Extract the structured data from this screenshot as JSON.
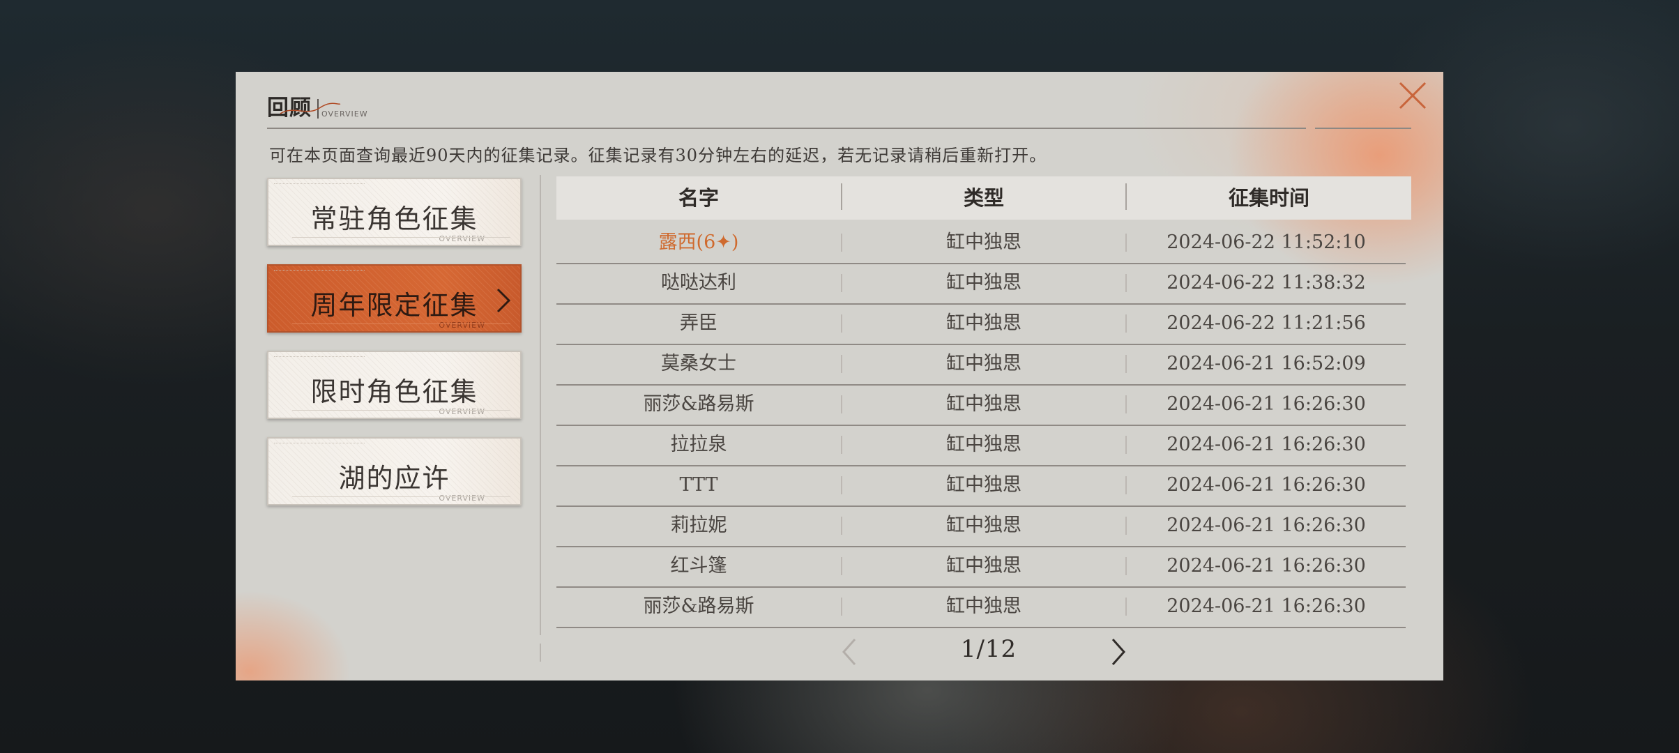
{
  "header": {
    "title": "回顾",
    "subtitle": "OVERVIEW",
    "description": "可在本页面查询最近90天内的征集记录。征集记录有30分钟左右的延迟，若无记录请稍后重新打开。"
  },
  "categories": [
    {
      "label": "常驻角色征集",
      "tag": "OVERVIEW",
      "active": false
    },
    {
      "label": "周年限定征集",
      "tag": "OVERVIEW",
      "active": true
    },
    {
      "label": "限时角色征集",
      "tag": "OVERVIEW",
      "active": false
    },
    {
      "label": "湖的应许",
      "tag": "OVERVIEW",
      "active": false
    }
  ],
  "table": {
    "columns": [
      "名字",
      "类型",
      "征集时间"
    ],
    "rows": [
      {
        "name": "露西(6✦)",
        "type": "缸中独思",
        "time": "2024-06-22 11:52:10",
        "highlight": true
      },
      {
        "name": "哒哒达利",
        "type": "缸中独思",
        "time": "2024-06-22 11:38:32"
      },
      {
        "name": "弄臣",
        "type": "缸中独思",
        "time": "2024-06-22 11:21:56"
      },
      {
        "name": "莫桑女士",
        "type": "缸中独思",
        "time": "2024-06-21 16:52:09"
      },
      {
        "name": "丽莎&路易斯",
        "type": "缸中独思",
        "time": "2024-06-21 16:26:30"
      },
      {
        "name": "拉拉泉",
        "type": "缸中独思",
        "time": "2024-06-21 16:26:30"
      },
      {
        "name": "TTT",
        "type": "缸中独思",
        "time": "2024-06-21 16:26:30"
      },
      {
        "name": "莉拉妮",
        "type": "缸中独思",
        "time": "2024-06-21 16:26:30"
      },
      {
        "name": "红斗篷",
        "type": "缸中独思",
        "time": "2024-06-21 16:26:30"
      },
      {
        "name": "丽莎&路易斯",
        "type": "缸中独思",
        "time": "2024-06-21 16:26:30"
      }
    ]
  },
  "pagination": {
    "current": 1,
    "total": 12,
    "label": "1/12"
  },
  "icons": {
    "close": "close-icon",
    "prev": "chevron-left-icon",
    "next": "chevron-right-icon",
    "active_arrow": "chevron-right-icon"
  },
  "colors": {
    "accent": "#cc5c2c",
    "highlight_text": "#cf6a2e",
    "panel_bg": "#d3d2cd"
  }
}
